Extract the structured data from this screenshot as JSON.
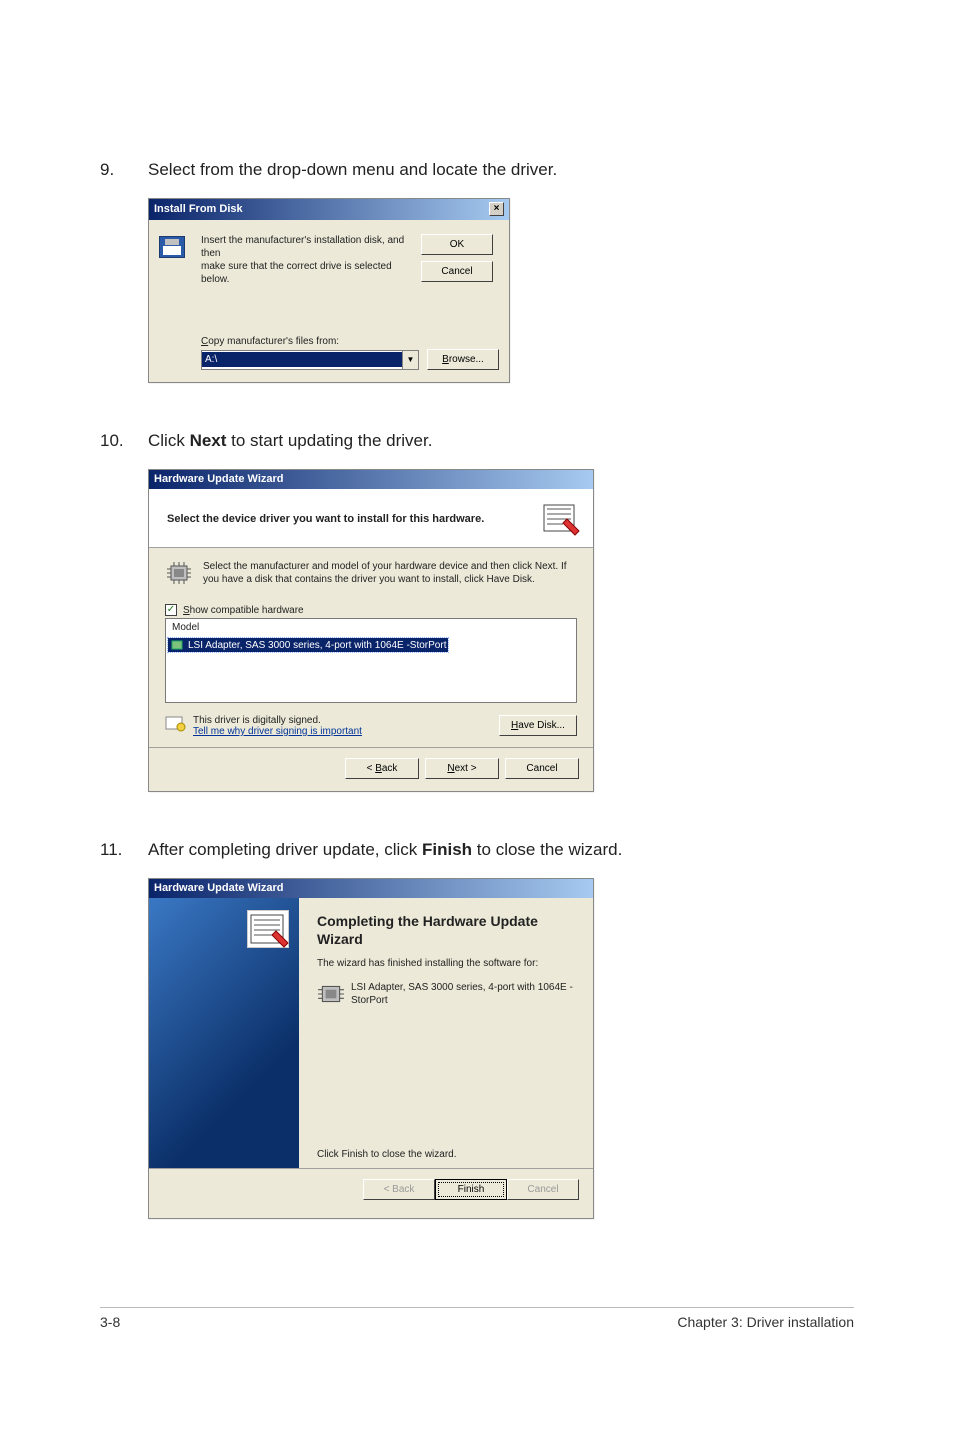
{
  "steps": {
    "s9_num": "9.",
    "s9_text": "Select from the drop-down menu and locate the driver.",
    "s10_num": "10.",
    "s10_pre": "Click ",
    "s10_bold": "Next",
    "s10_post": " to start updating the driver.",
    "s11_num": "11.",
    "s11_pre": "After completing driver update, click ",
    "s11_bold": "Finish",
    "s11_post": " to close the wizard."
  },
  "dlg1": {
    "title": "Install From Disk",
    "close": "×",
    "msg1": "Insert the manufacturer's installation disk, and then",
    "msg2": "make sure that the correct drive is selected below.",
    "ok": "OK",
    "cancel": "Cancel",
    "copy_label": "Copy manufacturer's files from:",
    "copy_u": "C",
    "combo_value": "A:\\",
    "browse": "Browse...",
    "browse_u": "B"
  },
  "dlg2": {
    "title": "Hardware Update Wizard",
    "head": "Select the device driver you want to install for this hardware.",
    "info": "Select the manufacturer and model of your hardware device and then click Next. If you have a disk that contains the driver you want to install, click Have Disk.",
    "chk": "Show compatible hardware",
    "chk_u": "S",
    "chk_mark": "✓",
    "model_head": "Model",
    "model_item": "LSI Adapter, SAS 3000 series, 4-port with 1064E -StorPort",
    "signed": "This driver is digitally signed.",
    "link": "Tell me why driver signing is important",
    "have_disk": "Have Disk...",
    "have_u": "H",
    "back": "< Back",
    "back_u": "B",
    "next": "Next >",
    "next_u": "N",
    "cancel": "Cancel"
  },
  "dlg3": {
    "title": "Hardware Update Wizard",
    "h": "Completing the Hardware Update Wizard",
    "sub": "The wizard has finished installing the software for:",
    "dev": "LSI Adapter, SAS 3000 series, 4-port with 1064E -StorPort",
    "bottom": "Click Finish to close the wizard.",
    "back": "< Back",
    "finish": "Finish",
    "cancel": "Cancel"
  },
  "footer": {
    "left": "3-8",
    "right": "Chapter 3: Driver installation"
  }
}
